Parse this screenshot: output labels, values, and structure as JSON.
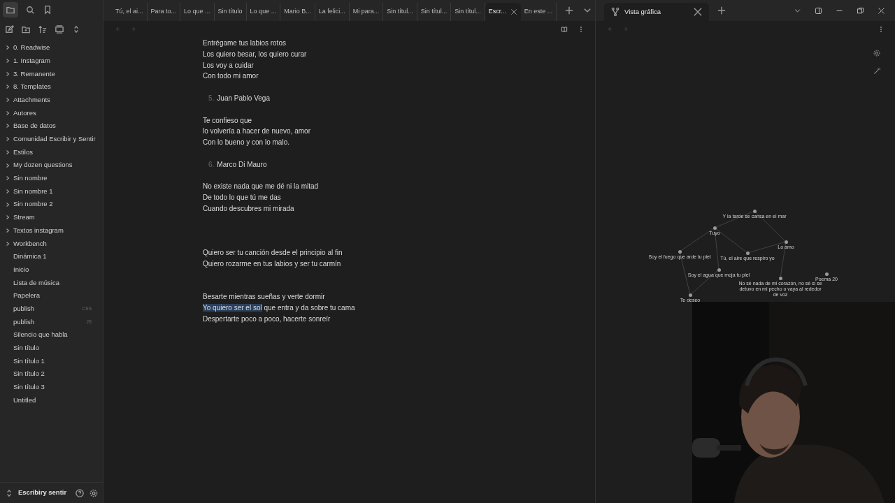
{
  "sidebar": {
    "items": [
      {
        "kind": "folder",
        "label": "0. Readwise"
      },
      {
        "kind": "folder",
        "label": "1. Instagram"
      },
      {
        "kind": "folder",
        "label": "3. Remanente"
      },
      {
        "kind": "folder",
        "label": "8. Templates"
      },
      {
        "kind": "folder",
        "label": "Attachments"
      },
      {
        "kind": "folder",
        "label": "Autores"
      },
      {
        "kind": "folder",
        "label": "Base de datos"
      },
      {
        "kind": "folder",
        "label": "Comunidad Escribir y Sentir"
      },
      {
        "kind": "folder",
        "label": "Estilos"
      },
      {
        "kind": "folder",
        "label": "My dozen questions"
      },
      {
        "kind": "folder",
        "label": "Sin nombre"
      },
      {
        "kind": "folder",
        "label": "Sin nombre 1"
      },
      {
        "kind": "folder",
        "label": "Sin nombre 2"
      },
      {
        "kind": "folder",
        "label": "Stream"
      },
      {
        "kind": "folder",
        "label": "Textos instagram"
      },
      {
        "kind": "folder",
        "label": "Workbench"
      },
      {
        "kind": "file",
        "label": "Dinámica 1"
      },
      {
        "kind": "file",
        "label": "Inicio"
      },
      {
        "kind": "file",
        "label": "Lista de música"
      },
      {
        "kind": "file",
        "label": "Papelera"
      },
      {
        "kind": "file",
        "label": "publish",
        "badge": "CSS"
      },
      {
        "kind": "file",
        "label": "publish",
        "badge": "JS"
      },
      {
        "kind": "file",
        "label": "Silencio que habla"
      },
      {
        "kind": "file",
        "label": "Sin título"
      },
      {
        "kind": "file",
        "label": "Sin título 1"
      },
      {
        "kind": "file",
        "label": "Sin título 2"
      },
      {
        "kind": "file",
        "label": "Sin título 3"
      },
      {
        "kind": "file",
        "label": "Untitled"
      }
    ],
    "vault": "Escribiry sentir"
  },
  "tabs": [
    {
      "label": "Tú, el ai...",
      "selected": false
    },
    {
      "label": "Para to...",
      "selected": false
    },
    {
      "label": "Lo que ...",
      "selected": false
    },
    {
      "label": "Sin título",
      "selected": false
    },
    {
      "label": "Lo que ...",
      "selected": false
    },
    {
      "label": "Mario B...",
      "selected": false
    },
    {
      "label": "La felici...",
      "selected": false
    },
    {
      "label": "Mi para...",
      "selected": false
    },
    {
      "label": "Sin títul...",
      "selected": false
    },
    {
      "label": "Sin títul...",
      "selected": false
    },
    {
      "label": "Sin títul...",
      "selected": false
    },
    {
      "label": "Escr...",
      "selected": true
    },
    {
      "label": "En este ...",
      "selected": false
    }
  ],
  "editor": {
    "lines": [
      {
        "kind": "text",
        "text": "Entrégame tus labios rotos"
      },
      {
        "kind": "text",
        "text": "Los quiero besar, los quiero curar"
      },
      {
        "kind": "text",
        "text": "Los voy a cuidar"
      },
      {
        "kind": "text",
        "text": "Con todo mi amor"
      },
      {
        "kind": "blank"
      },
      {
        "kind": "numbered",
        "number": "5.",
        "text": "Juan Pablo Vega"
      },
      {
        "kind": "blank"
      },
      {
        "kind": "text",
        "text": "Te confieso que"
      },
      {
        "kind": "text",
        "text": "lo volvería a hacer de nuevo, amor"
      },
      {
        "kind": "text",
        "text": "Con lo bueno y con lo malo."
      },
      {
        "kind": "blank"
      },
      {
        "kind": "numbered",
        "number": "6.",
        "text": "Marco Di Mauro"
      },
      {
        "kind": "blank"
      },
      {
        "kind": "text",
        "text": "No existe nada que me dé ni la mitad"
      },
      {
        "kind": "text",
        "text": "De todo lo que tú me das"
      },
      {
        "kind": "text",
        "text": "Cuando descubres mi mirada"
      },
      {
        "kind": "blank"
      },
      {
        "kind": "blank"
      },
      {
        "kind": "blank"
      },
      {
        "kind": "text",
        "text": "Quiero ser tu canción desde el principio al fin"
      },
      {
        "kind": "text",
        "text": "Quiero rozarme en tus labios y ser tu carmín"
      },
      {
        "kind": "blank"
      },
      {
        "kind": "blank"
      },
      {
        "kind": "text",
        "text": "Besarte mientras sueñas y verte dormir"
      },
      {
        "kind": "segments",
        "segments": [
          {
            "text": "Yo quiero ser el sol",
            "selected": true
          },
          {
            "text": " que entra y da sobre tu cama",
            "selected": false
          }
        ]
      },
      {
        "kind": "text",
        "text": "Despertarte poco a poco, hacerte sonreír"
      }
    ]
  },
  "graph_tab": {
    "title": "Vista gráfica"
  },
  "graph": {
    "nodes": [
      {
        "label": "Y la tarde se cansa en el mar"
      },
      {
        "label": "Tuyo"
      },
      {
        "label": "Lo amo"
      },
      {
        "label": "Soy el fuego que arde tu piel"
      },
      {
        "label": "Tú, el aire que respiro yo"
      },
      {
        "label": "Soy el agua que moja tu piel"
      },
      {
        "label": "No sé nada de mi corazón, no sé si se detuvo en mi pecho o vaya al rededor de voz"
      },
      {
        "label": "Poema 20"
      },
      {
        "label": "Te deseo"
      }
    ]
  }
}
